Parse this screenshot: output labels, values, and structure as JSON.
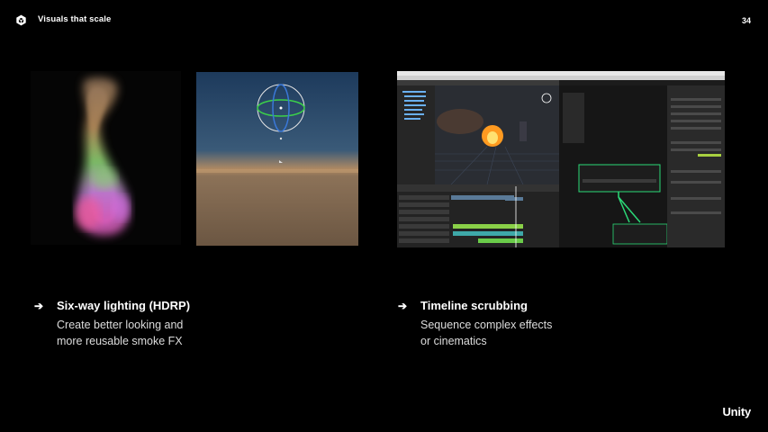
{
  "header": {
    "title": "Visuals that scale",
    "page_number": "34"
  },
  "features": [
    {
      "heading": "Six-way lighting (HDRP)",
      "desc_line1": "Create better looking and",
      "desc_line2": "more reusable smoke FX"
    },
    {
      "heading": "Timeline scrubbing",
      "desc_line1": "Sequence complex effects",
      "desc_line2": "or cinematics"
    }
  ],
  "footer": {
    "brand": "Unity"
  },
  "icons": {
    "logo": "unity-cube-icon",
    "bullet": "arrow-right-icon"
  },
  "colors": {
    "background": "#000000",
    "text": "#ffffff",
    "accent_green": "#2bd977"
  }
}
